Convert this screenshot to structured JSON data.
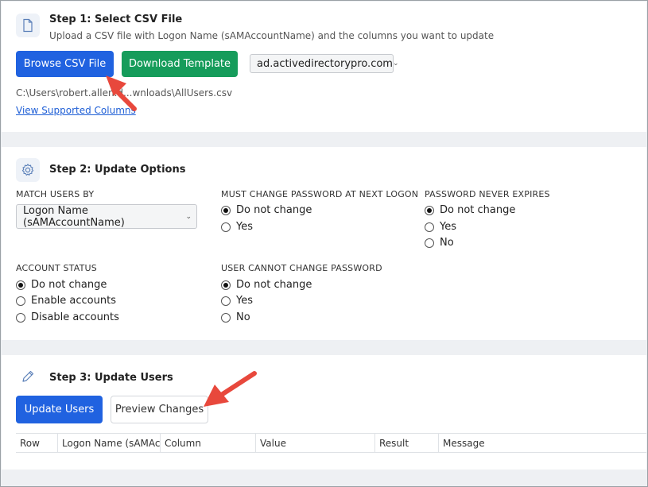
{
  "step1": {
    "title": "Step 1: Select CSV File",
    "subtitle": "Upload a CSV file with Logon Name (sAMAccountName) and the columns you want to update",
    "browse_label": "Browse CSV File",
    "download_label": "Download Template",
    "domain_selected": "ad.activedirectorypro.com",
    "file_path": "C:\\Users\\robert.allen.d...wnloads\\AllUsers.csv",
    "supported_link": "View Supported Columns"
  },
  "step2": {
    "title": "Step 2: Update Options",
    "match_users": {
      "label": "MATCH USERS BY",
      "selected": "Logon Name (sAMAccountName)"
    },
    "must_change": {
      "label": "MUST CHANGE PASSWORD AT NEXT LOGON",
      "options": [
        "Do not change",
        "Yes"
      ],
      "selected_index": 0
    },
    "never_expires": {
      "label": "PASSWORD NEVER EXPIRES",
      "options": [
        "Do not change",
        "Yes",
        "No"
      ],
      "selected_index": 0
    },
    "account_status": {
      "label": "ACCOUNT STATUS",
      "options": [
        "Do not change",
        "Enable accounts",
        "Disable accounts"
      ],
      "selected_index": 0
    },
    "cannot_change": {
      "label": "USER CANNOT CHANGE PASSWORD",
      "options": [
        "Do not change",
        "Yes",
        "No"
      ],
      "selected_index": 0
    }
  },
  "step3": {
    "title": "Step 3: Update Users",
    "update_label": "Update Users",
    "preview_label": "Preview Changes",
    "columns": [
      "Row",
      "Logon Name (sAMAccountName)",
      "Column",
      "Value",
      "Result",
      "Message"
    ]
  },
  "colors": {
    "primary": "#2062e0",
    "success": "#169c5b",
    "arrow": "#e8483c"
  },
  "icons": {
    "step1": "file-icon",
    "step2": "gear-icon",
    "step3": "pencil-icon"
  }
}
